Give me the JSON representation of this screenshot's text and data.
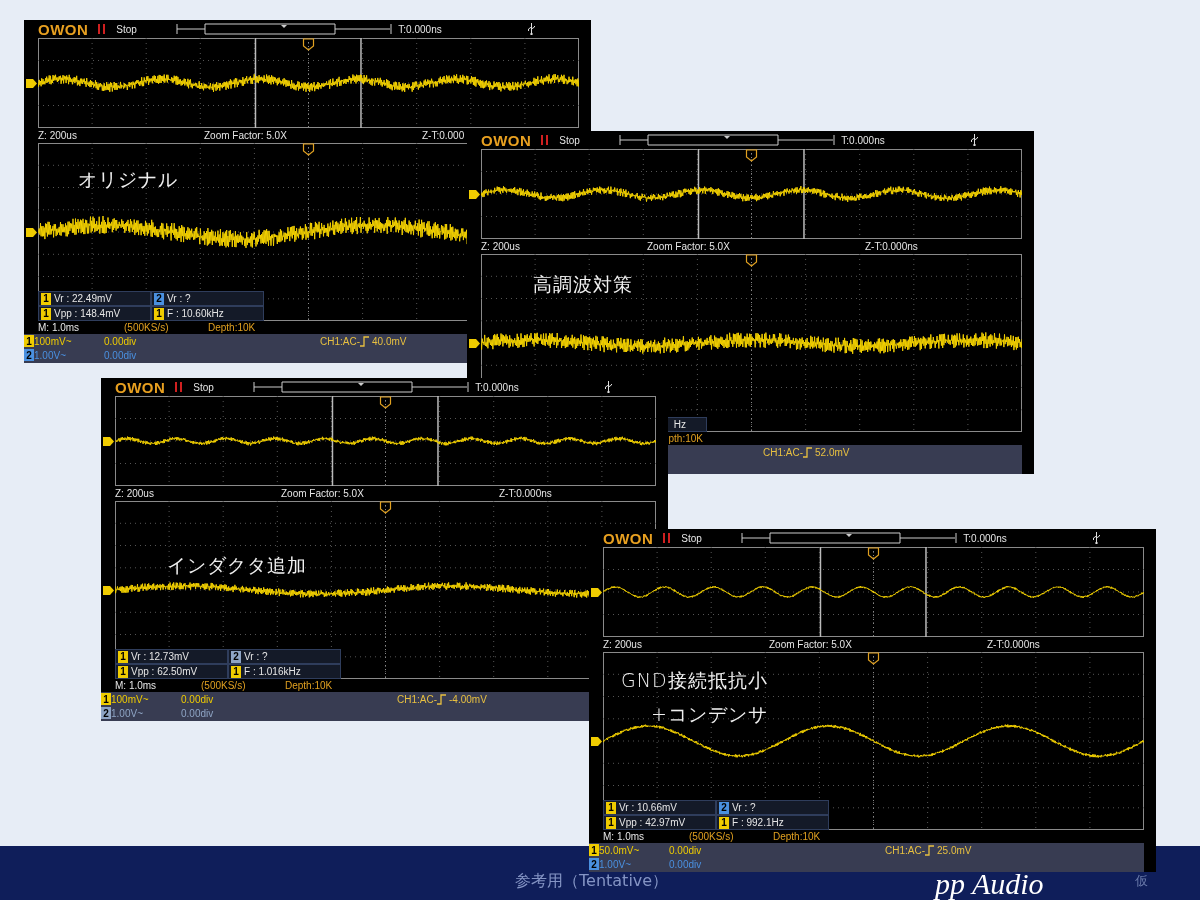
{
  "scopes": [
    {
      "brand": "OWON",
      "status": "Stop",
      "trigger_time": "T:0.000ns",
      "zoom_base": "Z: 200us",
      "zoom_factor": "Zoom Factor: 5.0X",
      "zoom_time": "Z-T:0.000",
      "annotations": [
        {
          "text": "オリジナル"
        }
      ],
      "measurements": {
        "cell_1": {
          "channel": "1",
          "color": "#f0cc00",
          "text": "Vr : 22.49mV"
        },
        "cell_2": {
          "channel": "2",
          "color": "#4a90e0",
          "text": "Vr :     ?"
        },
        "cell_3": {
          "channel": "1",
          "color": "#f0cc00",
          "text": "Vpp : 148.4mV"
        },
        "cell_4": {
          "channel": "1",
          "color": "#f0cc00",
          "text": "F : 10.60kHz"
        }
      },
      "timebase": "M: 1.0ms",
      "sample_rate": "(500KS/s)",
      "depth": "Depth:10K",
      "channels": [
        {
          "number": "1",
          "color": "#f0cc00",
          "scale": "100mV~",
          "offset": "0.00div"
        },
        {
          "number": "2",
          "color": "#4a90e0",
          "scale": "1.00V~",
          "offset": "0.00div"
        }
      ],
      "trigger_source": "CH1:AC-",
      "trigger_level": "40.0mV"
    },
    {
      "brand": "OWON",
      "status": "Stop",
      "trigger_time": "T:0.000ns",
      "zoom_base": "Z: 200us",
      "zoom_factor": "Zoom Factor: 5.0X",
      "zoom_time": "Z-T:0.000ns",
      "annotations": [
        {
          "text": "高調波対策"
        }
      ],
      "measurements": {
        "cell_4": {
          "text": "Hz",
          "cut": true
        }
      },
      "depth": "pth:10K",
      "depth_cut": true,
      "trigger_source": "CH1:AC-",
      "trigger_level": "52.0mV"
    },
    {
      "brand": "OWON",
      "status": "Stop",
      "trigger_time": "T:0.000ns",
      "zoom_base": "Z: 200us",
      "zoom_factor": "Zoom Factor: 5.0X",
      "zoom_time": "Z-T:0.000ns",
      "annotations": [
        {
          "text": "インダクタ追加"
        }
      ],
      "measurements": {
        "cell_1": {
          "channel": "1",
          "color": "#f0cc00",
          "text": "Vr : 12.73mV"
        },
        "cell_2": {
          "channel": "2",
          "color": "#8ea4c4",
          "text": "Vr :     ?"
        },
        "cell_3": {
          "channel": "1",
          "color": "#f0cc00",
          "text": "Vpp : 62.50mV"
        },
        "cell_4": {
          "channel": "1",
          "color": "#f0cc00",
          "text": "F : 1.016kHz"
        }
      },
      "timebase": "M: 1.0ms",
      "sample_rate": "(500KS/s)",
      "depth": "Depth:10K",
      "channels": [
        {
          "number": "1",
          "color": "#f0cc00",
          "scale": "100mV~",
          "offset": "0.00div"
        },
        {
          "number": "2",
          "color": "#8ea4c4",
          "scale": "1.00V~",
          "offset": "0.00div"
        }
      ],
      "trigger_source": "CH1:AC-",
      "trigger_level": "-4.00mV"
    },
    {
      "brand": "OWON",
      "status": "Stop",
      "trigger_time": "T:0.000ns",
      "zoom_base": "Z: 200us",
      "zoom_factor": "Zoom Factor: 5.0X",
      "zoom_time": "Z-T:0.000ns",
      "annotations": [
        {
          "text": "GND接続抵抗小"
        },
        {
          "text": "+コンデンサ"
        }
      ],
      "measurements": {
        "cell_1": {
          "channel": "1",
          "color": "#f0cc00",
          "text": "Vr : 10.66mV"
        },
        "cell_2": {
          "channel": "2",
          "color": "#4a90e0",
          "text": "Vr :     ?"
        },
        "cell_3": {
          "channel": "1",
          "color": "#f0cc00",
          "text": "Vpp : 42.97mV"
        },
        "cell_4": {
          "channel": "1",
          "color": "#f0cc00",
          "text": "F : 992.1Hz"
        }
      },
      "timebase": "M: 1.0ms",
      "sample_rate": "(500KS/s)",
      "depth": "Depth:10K",
      "channels": [
        {
          "number": "1",
          "color": "#f0cc00",
          "scale": "50.0mV~",
          "offset": "0.00div"
        },
        {
          "number": "2",
          "color": "#4a90e0",
          "scale": "1.00V~",
          "offset": "0.00div"
        }
      ],
      "trigger_source": "CH1:AC-",
      "trigger_level": "25.0mV"
    }
  ],
  "footer": {
    "caption": "参考用（Tentative）",
    "logo": "pp Audio",
    "mark": "仮"
  }
}
